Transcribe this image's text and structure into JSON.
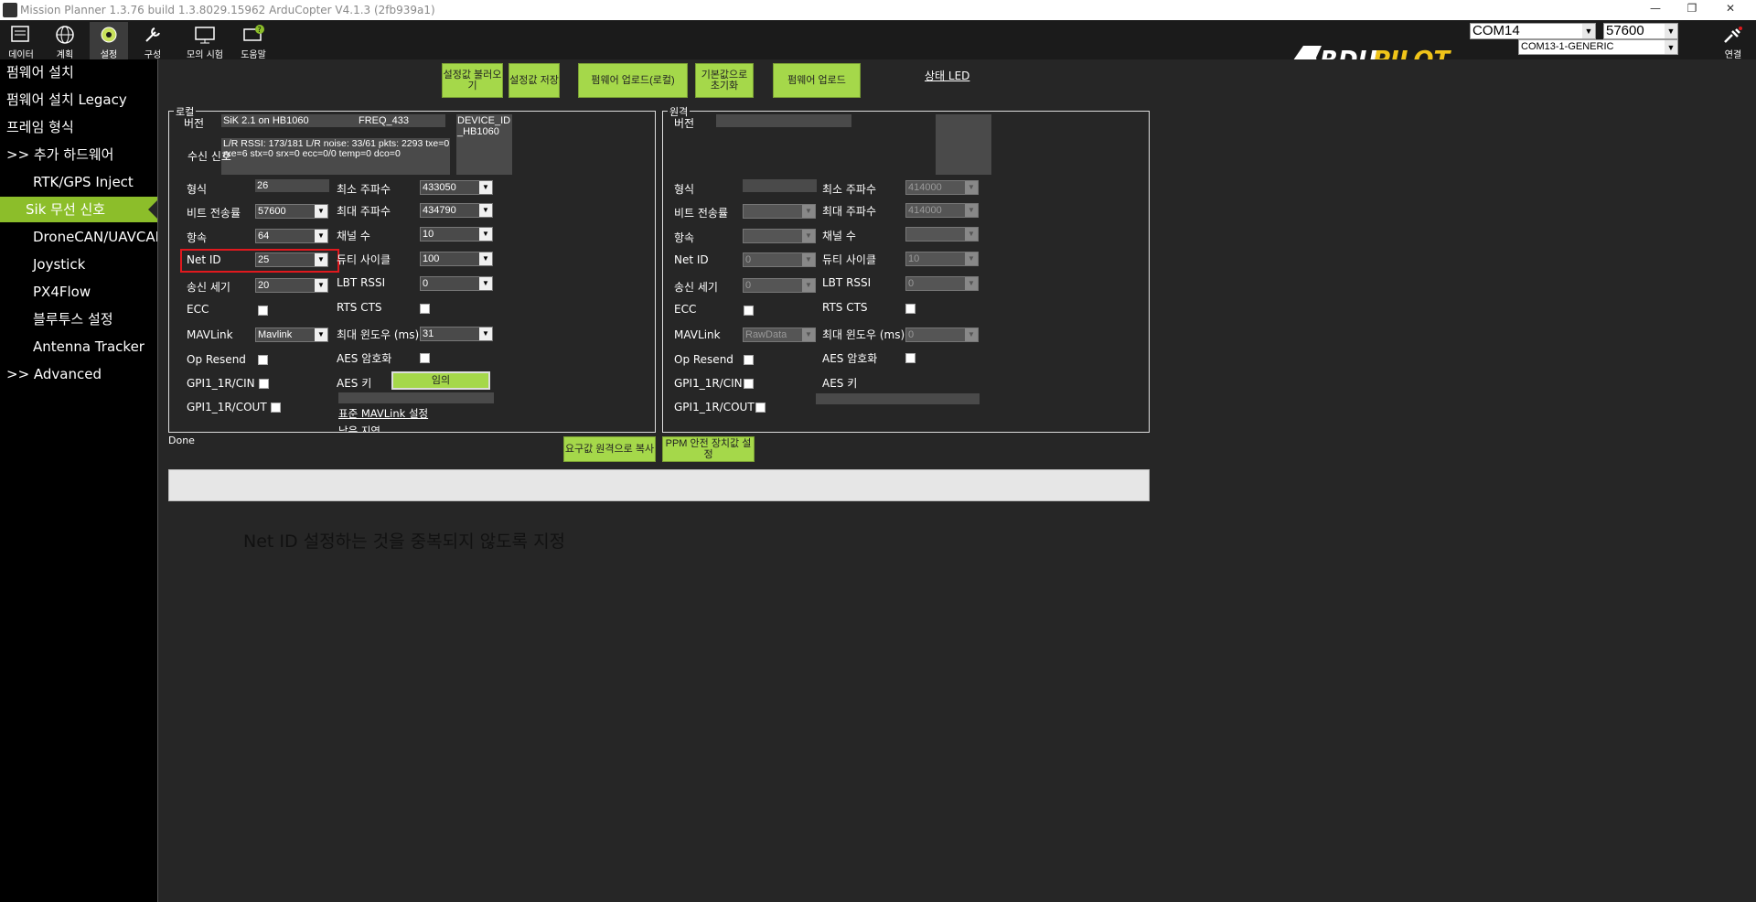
{
  "window": {
    "title": "Mission Planner 1.3.76 build 1.3.8029.15962 ArduCopter V4.1.3 (2fb939a1)",
    "min": "—",
    "restore": "❐",
    "close": "✕"
  },
  "toolbar": {
    "items": [
      {
        "label": "데이터",
        "icon": "data-icon"
      },
      {
        "label": "계획",
        "icon": "plan-globe-icon"
      },
      {
        "label": "설정",
        "icon": "setup-gear-icon"
      },
      {
        "label": "구성",
        "icon": "config-wrench-icon"
      },
      {
        "label": "모의 시험",
        "icon": "simulation-icon"
      },
      {
        "label": "도움말",
        "icon": "help-icon"
      }
    ],
    "port": "COM14",
    "baud": "57600",
    "port_detail": "COM13-1-GENERIC",
    "connect": "연결",
    "logo_text_1": "ARDU",
    "logo_text_2": "PILOT"
  },
  "sidebar": {
    "items": [
      {
        "label": "펌웨어 설치"
      },
      {
        "label": "펌웨어 설치 Legacy"
      },
      {
        "label": "프레임 형식"
      },
      {
        "label": ">> 추가 하드웨어"
      },
      {
        "label": "RTK/GPS Inject"
      },
      {
        "label": "Sik 무선 신호"
      },
      {
        "label": "DroneCAN/UAVCAN"
      },
      {
        "label": "Joystick"
      },
      {
        "label": "PX4Flow"
      },
      {
        "label": "블루투스 설정"
      },
      {
        "label": "Antenna Tracker"
      },
      {
        "label": ">> Advanced"
      }
    ]
  },
  "buttons": {
    "load_settings": "설정값 불러오기",
    "save_settings": "설정값 저장",
    "upload_fw_local": "펌웨어 업로드(로컬)",
    "reset_defaults": "기본값으로 초기화",
    "upload_fw": "펌웨어 업로드",
    "status_led": "상태 LED",
    "copy_to_remote": "요구값 원격으로 복사",
    "ppm_failsafe": "PPM 안전 장치값 설정",
    "random": "임의"
  },
  "local": {
    "legend": "로컬",
    "version_label": "버전",
    "version": "SiK 2.1 on HB1060",
    "freq": "FREQ_433",
    "device_id": "DEVICE_ID_HB1060",
    "rssi_label": "수신 신호",
    "rssi": "L/R RSSI: 173/181  L/R noise: 33/61 pkts: 2293  txe=0 rxe=6 stx=0 srx=0 ecc=0/0 temp=0 dco=0",
    "format_label": "형식",
    "format": "26",
    "baud_label": "비트 전송률",
    "baud": "57600",
    "airspeed_label": "항속",
    "airspeed": "64",
    "netid_label": "Net ID",
    "netid": "25",
    "txpower_label": "송신 세기",
    "txpower": "20",
    "ecc_label": "ECC",
    "mavlink_label": "MAVLink",
    "mavlink": "Mavlink",
    "opresend_label": "Op Resend",
    "gpi1_cin_label": "GPI1_1R/CIN",
    "gpi1_cout_label": "GPI1_1R/COUT",
    "minfreq_label": "최소 주파수",
    "minfreq": "433050",
    "maxfreq_label": "최대 주파수",
    "maxfreq": "434790",
    "channels_label": "채널 수",
    "channels": "10",
    "duty_label": "듀티 사이클",
    "duty": "100",
    "lbt_label": "LBT RSSI",
    "lbt": "0",
    "rtscts_label": "RTS CTS",
    "maxwindow_label": "최대 윈도우 (ms)",
    "maxwindow": "31",
    "aes_label": "AES 암호화",
    "aeskey_label": "AES 키",
    "mavlink_std": "표준 MAVLink 설정",
    "low_latency": "낮은 지연"
  },
  "remote": {
    "legend": "원격",
    "version_label": "버전",
    "format_label": "형식",
    "baud_label": "비트 전송률",
    "airspeed_label": "항속",
    "netid_label": "Net ID",
    "netid": "0",
    "txpower_label": "송신 세기",
    "txpower": "0",
    "ecc_label": "ECC",
    "mavlink_label": "MAVLink",
    "mavlink": "RawData",
    "opresend_label": "Op Resend",
    "gpi1_cin_label": "GPI1_1R/CIN",
    "gpi1_cout_label": "GPI1_1R/COUT",
    "minfreq_label": "최소 주파수",
    "minfreq": "414000",
    "maxfreq_label": "최대 주파수",
    "maxfreq": "414000",
    "channels_label": "채널 수",
    "duty_label": "듀티 사이클",
    "duty": "10",
    "lbt_label": "LBT RSSI",
    "lbt": "0",
    "rtscts_label": "RTS CTS",
    "maxwindow_label": "최대 윈도우 (ms)",
    "maxwindow": "0",
    "aes_label": "AES 암호화",
    "aeskey_label": "AES 키"
  },
  "status": {
    "text": "Done"
  },
  "annotation": "Net ID 설정하는 것을 중복되지 않도록 지정",
  "colors": {
    "accent": "#8cbe2a",
    "button": "#a5d84a",
    "highlight": "#e0191e"
  }
}
